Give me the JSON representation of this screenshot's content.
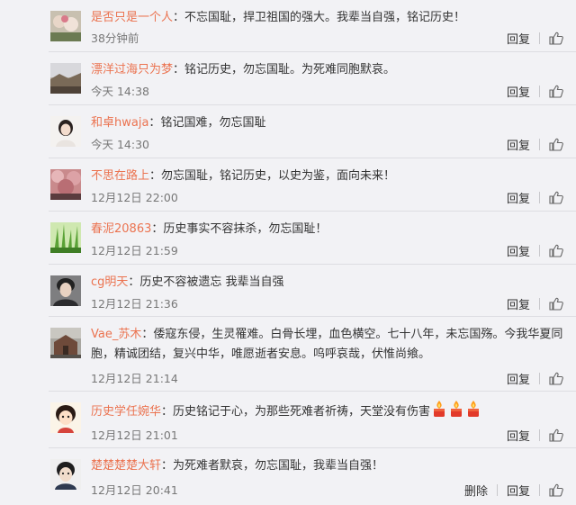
{
  "comments": [
    {
      "nick": "是否只是一个人",
      "text": "不忘国耻，捍卫祖国的强大。我辈当自强，铭记历史！",
      "time": "38分钟前",
      "actions": {
        "reply": "回复"
      },
      "avatar": "avatar-flowers"
    },
    {
      "nick": "漂洋过海只为梦",
      "text": "铭记历史，勿忘国耻。为死难同胞默哀。",
      "time": "今天 14:38",
      "actions": {
        "reply": "回复"
      },
      "avatar": "avatar-landscape"
    },
    {
      "nick": "和卓hwaja",
      "text": "铭记国难，勿忘国耻",
      "time": "今天 14:30",
      "actions": {
        "reply": "回复"
      },
      "avatar": "avatar-girl"
    },
    {
      "nick": "不思在路上",
      "text": "勿忘国耻，铭记历史，以史为鉴，面向未来！",
      "time": "12月12日 22:00",
      "actions": {
        "reply": "回复"
      },
      "avatar": "avatar-blossom"
    },
    {
      "nick": "春泥20863",
      "text": "历史事实不容抹杀，勿忘国耻！",
      "time": "12月12日 21:59",
      "actions": {
        "reply": "回复"
      },
      "avatar": "avatar-grass"
    },
    {
      "nick": "cg明天",
      "text": "历史不容被遗忘 我辈当自强",
      "time": "12月12日 21:36",
      "actions": {
        "reply": "回复"
      },
      "avatar": "avatar-man"
    },
    {
      "nick": "Vae_苏木",
      "text": "倭寇东侵，生灵罹难。白骨长埋，血色横空。七十八年，未忘国殇。今我华夏同胞，精诚团结，复兴中华，唯愿逝者安息。呜呼哀哉，伏惟尚飨。",
      "time": "12月12日 21:14",
      "actions": {
        "reply": "回复"
      },
      "avatar": "avatar-building"
    },
    {
      "nick": "历史学任婉华",
      "text": "历史铭记于心，为那些死难者祈祷，天堂没有伤害",
      "time": "12月12日 21:01",
      "actions": {
        "reply": "回复"
      },
      "avatar": "avatar-cartoon",
      "emoji": [
        "candle-icon",
        "candle-icon",
        "candle-icon"
      ]
    },
    {
      "nick": "楚楚楚楚大轩",
      "text": "为死难者默哀，勿忘国耻，我辈当自强！",
      "time": "12月12日 20:41",
      "actions": {
        "delete": "删除",
        "reply": "回复"
      },
      "avatar": "avatar-boy"
    }
  ],
  "colors": {
    "nickname": "#eb7350",
    "background": "#f2f2f5",
    "time": "#777777"
  }
}
